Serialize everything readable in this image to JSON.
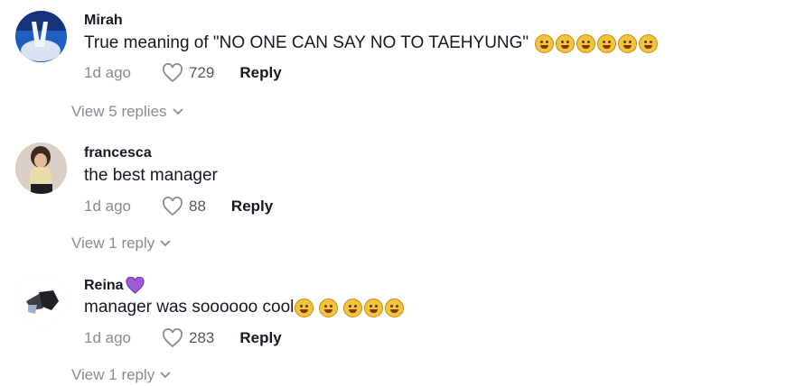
{
  "comments": [
    {
      "username": "Mirah",
      "text": "True meaning of \"NO ONE CAN SAY NO TO TAEHYUNG\"",
      "emojis": [
        "rolling-laughing-emoji",
        "rolling-laughing-emoji",
        "rolling-laughing-emoji",
        "rolling-laughing-emoji",
        "rolling-laughing-emoji",
        "rolling-laughing-emoji"
      ],
      "time": "1d ago",
      "likes": "729",
      "reply_label": "Reply",
      "view_replies": "View 5 replies"
    },
    {
      "username": "francesca",
      "text": "the best manager",
      "emojis": [],
      "time": "1d ago",
      "likes": "88",
      "reply_label": "Reply",
      "view_replies": "View 1 reply"
    },
    {
      "username": "Reina",
      "username_badge": "purple-heart-icon",
      "text": "manager was soooooo cool",
      "emojis": [
        "flushed-face-emoji",
        "smirk-emoji",
        "rolling-laughing-emoji",
        "rolling-laughing-emoji",
        "rolling-laughing-emoji"
      ],
      "time": "1d ago",
      "likes": "283",
      "reply_label": "Reply",
      "view_replies": "View 1 reply"
    }
  ],
  "colors": {
    "text": "#161823",
    "secondary": "#8a8b91",
    "heart_badge": "#a259d9"
  }
}
